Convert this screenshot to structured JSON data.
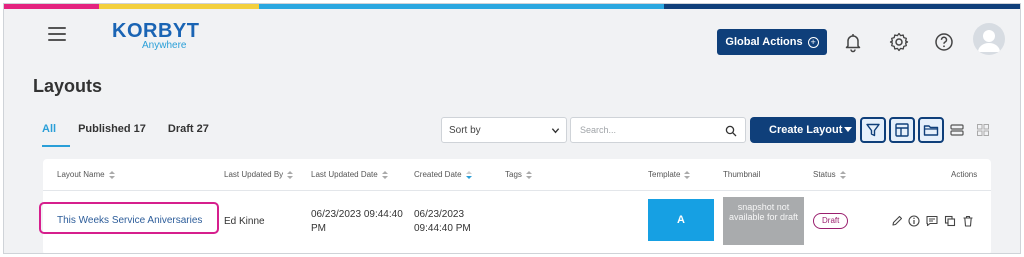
{
  "brand": {
    "logo_text": "KORBYT",
    "logo_sub": "Anywhere",
    "stripe_colors": [
      "#e4237f",
      "#f3d03e",
      "#2aa7e0",
      "#0f3f7a"
    ]
  },
  "header": {
    "global_actions_label": "Global Actions",
    "icons": [
      "menu-icon",
      "bell-icon",
      "gear-icon",
      "help-icon",
      "user-icon"
    ]
  },
  "page": {
    "title": "Layouts"
  },
  "tabs": [
    {
      "label": "All",
      "active": true
    },
    {
      "label": "Published 17",
      "active": false
    },
    {
      "label": "Draft 27",
      "active": false
    }
  ],
  "toolbar": {
    "sort_label": "Sort by",
    "search_placeholder": "Search...",
    "create_label": "Create Layout"
  },
  "table": {
    "headers": {
      "layout_name": "Layout Name",
      "last_updated_by": "Last Updated By",
      "last_updated_date": "Last Updated Date",
      "created_date": "Created Date",
      "tags": "Tags",
      "template": "Template",
      "thumbnail": "Thumbnail",
      "status": "Status",
      "actions": "Actions"
    },
    "rows": [
      {
        "layout_name": "This Weeks Service Aniversaries",
        "last_updated_by": "Ed Kinne",
        "last_updated_date_l1": "06/23/2023 09:44:40",
        "last_updated_date_l2": "PM",
        "created_date_l1": "06/23/2023",
        "created_date_l2": "09:44:40 PM",
        "tags": "",
        "template": "A",
        "thumbnail_text": "snapshot not available for draft",
        "status": "Draft"
      }
    ]
  },
  "colors": {
    "accent": "#2a9fd8",
    "primary": "#0f3f7a",
    "highlight": "#d61f8d",
    "draft": "#9a1f6e"
  }
}
